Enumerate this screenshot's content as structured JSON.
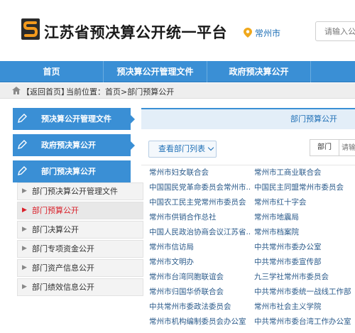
{
  "header": {
    "site_title": "江苏省预决算公开统一平台",
    "city": "常州市",
    "search_placeholder": "请输入公示"
  },
  "nav": {
    "items": [
      "首页",
      "预决算公开管理文件",
      "政府预决算公开"
    ]
  },
  "breadcrumb": {
    "back": "【返回首页】",
    "current": "当前位置：首页>部门预算公开"
  },
  "sidebar": {
    "sections": [
      {
        "label": "预决算公开管理文件"
      },
      {
        "label": "政府预决算公开"
      },
      {
        "label": "部门预决算公开"
      }
    ],
    "sub_items": [
      {
        "label": "部门预决算公开管理文件",
        "active": false
      },
      {
        "label": "部门预算公开",
        "active": true
      },
      {
        "label": "部门决算公开",
        "active": false
      },
      {
        "label": "部门专项资金公开",
        "active": false
      },
      {
        "label": "部门资产信息公开",
        "active": false
      },
      {
        "label": "部门绩效信息公开",
        "active": false
      }
    ]
  },
  "main": {
    "panel_title": "部门预算公开",
    "filter_button": "查看部门列表",
    "dept_select": "部门",
    "dept_input_placeholder": "请输",
    "departments_left": [
      "常州市妇女联合会",
      "中国国民党革命委员会常州市...",
      "中国农工民主党常州市委员会",
      "常州市供销合作总社",
      "中国人民政治协商会议江苏省...",
      "常州市信访局",
      "常州市文明办",
      "常州市台湾同胞联谊会",
      "常州市归国华侨联合会",
      "中共常州市委政法委员会",
      "常州市机构编制委员会办公室"
    ],
    "departments_right": [
      "常州市工商业联合会",
      "中国民主同盟常州市委员会",
      "常州市红十字会",
      "常州市地震局",
      "常州市档案院",
      "中共常州市委办公室",
      "中共常州市委宣传部",
      "九三学社常州市委员会",
      "中共常州市委统一战线工作部",
      "常州市社会主义学院",
      "中共常州市委台湾工作办公室"
    ]
  },
  "colors": {
    "primary_blue": "#3a8fd5",
    "active_red": "#d9202a",
    "link_blue": "#2a5a8a"
  }
}
